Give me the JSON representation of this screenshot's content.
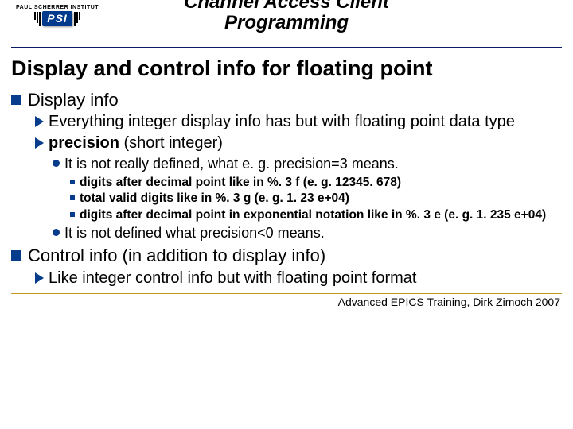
{
  "header": {
    "institute": "PAUL SCHERRER INSTITUT",
    "logo": "PSI",
    "title_line1": "Channel Access Client",
    "title_line2": "Programming"
  },
  "slide_title": "Display and control info for floating point",
  "b1": {
    "text": "Display info",
    "c1": "Everything integer display info has but with floating point data type",
    "c2_bold": "precision",
    "c2_rest": " (short integer)",
    "c2a": "It is not really defined, what e. g. precision=3 means.",
    "c2a1": "digits after decimal point like in %. 3 f (e. g. 12345. 678)",
    "c2a2": "total valid digits like in %. 3 g (e. g. 1. 23 e+04)",
    "c2a3": "digits after decimal point in exponential notation like in %. 3 e (e. g. 1. 235 e+04)",
    "c2b": "It is not defined what precision<0 means."
  },
  "b2": {
    "text": "Control info (in addition to display info)",
    "c1": "Like integer control info but with floating point format"
  },
  "footer": "Advanced EPICS Training, Dirk Zimoch 2007"
}
